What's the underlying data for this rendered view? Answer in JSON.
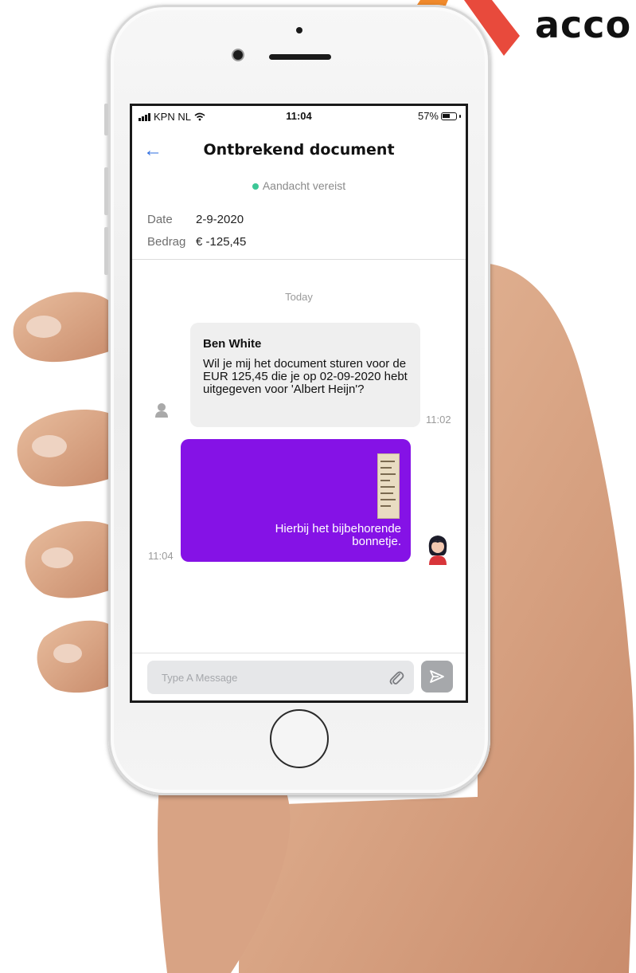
{
  "brand": {
    "logo_text": "acco",
    "accent_orange": "#f08a2c",
    "accent_red": "#e84a3c"
  },
  "status_bar": {
    "carrier": "KPN NL",
    "time": "11:04",
    "battery": "57%"
  },
  "header": {
    "title": "Ontbrekend document",
    "back_icon": "arrow-left-icon"
  },
  "attention": {
    "label": "Aandacht vereist",
    "dot_color": "#3cc796"
  },
  "details": {
    "date_label": "Date",
    "date_value": "2-9-2020",
    "amount_label": "Bedrag",
    "amount_value": "€ -125,45"
  },
  "chat": {
    "day_separator": "Today",
    "messages": [
      {
        "direction": "incoming",
        "sender": "Ben White",
        "text": "Wil je mij het document sturen voor de EUR 125,45 die je op 02-09-2020 hebt uitgegeven voor 'Albert Heijn'?",
        "time": "11:02"
      },
      {
        "direction": "outgoing",
        "attachment": "receipt-image",
        "text": "Hierbij het bijbehorende bonnetje.",
        "time": "11:04",
        "bubble_color": "#8512e6"
      }
    ]
  },
  "composer": {
    "placeholder": "Type A Message",
    "attach_icon": "paperclip-icon",
    "send_icon": "send-icon"
  }
}
